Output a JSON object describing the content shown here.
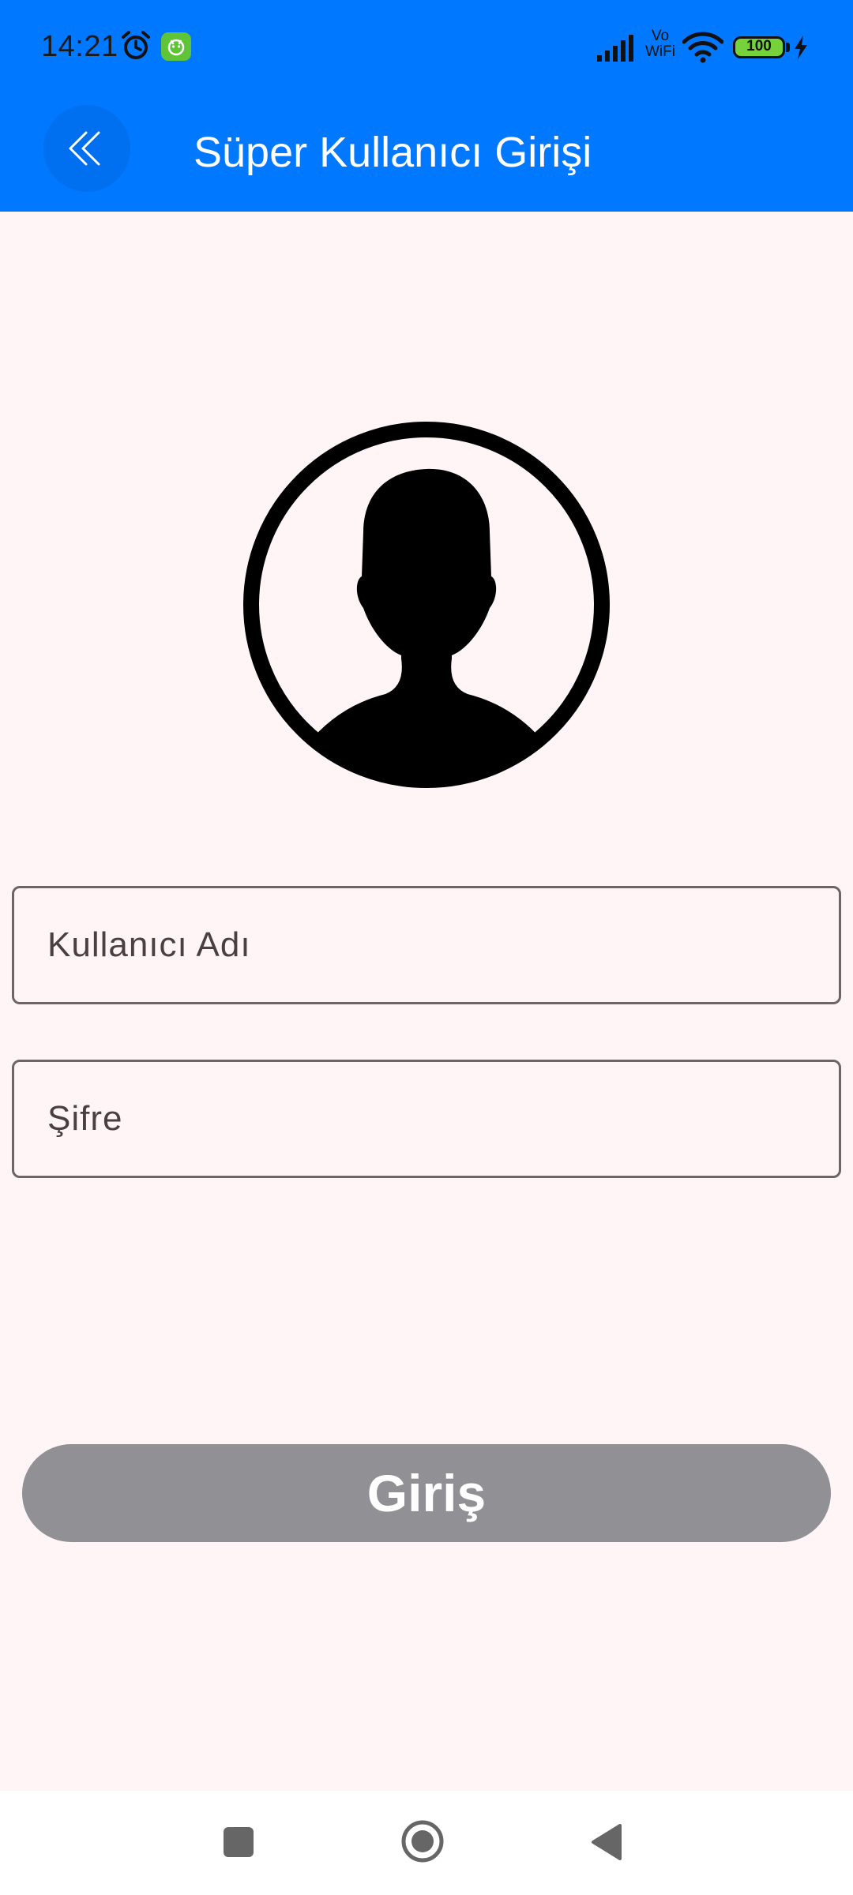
{
  "status_bar": {
    "time": "14:21",
    "vowifi_top": "Vo",
    "vowifi_bottom": "WiFi",
    "battery_level": "100",
    "icons": [
      "alarm-icon",
      "app-badge-icon",
      "signal-icon",
      "vowifi-icon",
      "wifi-icon",
      "battery-icon",
      "charging-icon"
    ]
  },
  "header": {
    "title": "Süper Kullanıcı Girişi",
    "back_icon": "double-chevron-left-icon",
    "background_color": "#0078FF"
  },
  "avatar": {
    "icon": "user-silhouette-icon"
  },
  "form": {
    "username_placeholder": "Kullanıcı Adı",
    "username_value": "",
    "password_placeholder": "Şifre",
    "password_value": ""
  },
  "login_button": {
    "label": "Giriş",
    "color": "#919094"
  },
  "nav_bar": {
    "icons": [
      "recents-icon",
      "home-icon",
      "back-icon"
    ]
  }
}
